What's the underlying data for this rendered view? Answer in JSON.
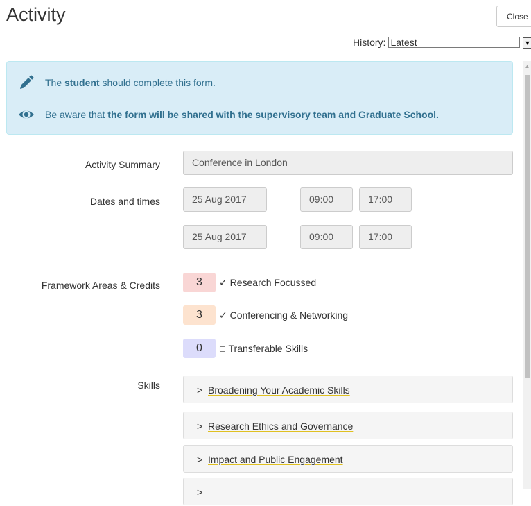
{
  "page": {
    "title": "Activity"
  },
  "toolbar": {
    "close_label": "Close"
  },
  "history": {
    "label": "History:",
    "selected": "Latest"
  },
  "info": {
    "line1_pre": "The ",
    "line1_bold": "student",
    "line1_post": " should complete this form.",
    "line2_pre": "Be aware that ",
    "line2_bold": "the form will be shared with the supervisory team and Graduate School."
  },
  "form": {
    "activity_summary_label": "Activity Summary",
    "activity_summary_value": "Conference in London",
    "dates_label": "Dates and times",
    "dates": [
      {
        "date": "25 Aug 2017",
        "start": "09:00",
        "end": "17:00"
      },
      {
        "date": "25 Aug 2017",
        "start": "09:00",
        "end": "17:00"
      }
    ],
    "framework_label": "Framework Areas & Credits",
    "framework": [
      {
        "credits": "3",
        "mark": "✓",
        "name": "Research Focussed",
        "color": "#f9d6d5"
      },
      {
        "credits": "3",
        "mark": "✓",
        "name": "Conferencing & Networking",
        "color": "#fde3cf"
      },
      {
        "credits": "0",
        "mark": "☐",
        "name": "Transferable Skills",
        "color": "#dcdcfb"
      }
    ],
    "skills_label": "Skills",
    "skills": [
      "Broadening Your Academic Skills",
      "Research Ethics and Governance",
      "Impact and Public Engagement"
    ]
  },
  "colors": {
    "info_bg": "#d9edf7",
    "info_text": "#31708f",
    "link_underline": "#e0c020"
  },
  "icons": [
    "pencil-icon",
    "eye-icon",
    "chevron-right-icon"
  ]
}
